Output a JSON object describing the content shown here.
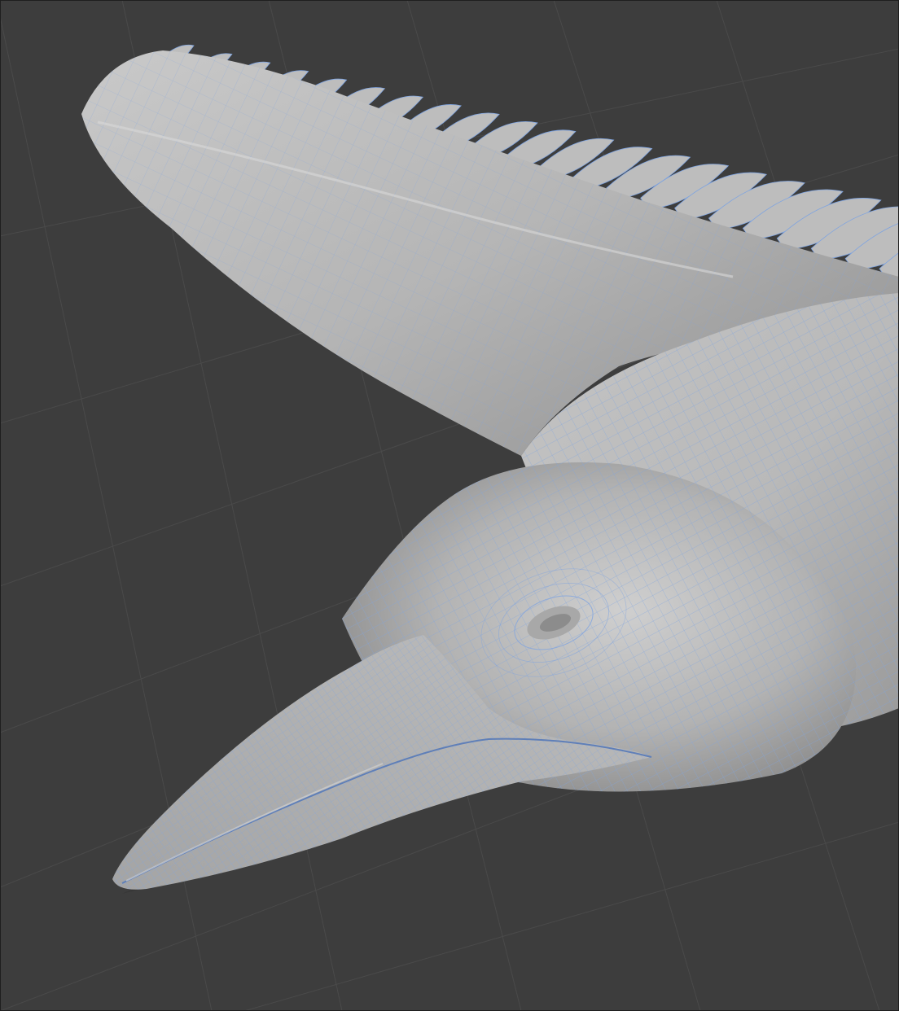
{
  "viewport": {
    "background": "#3d3d3d",
    "grid_color": "#4a4a4a",
    "mesh_color": "#b4b4b4",
    "wire_color": "#7fa4e0",
    "shadow_color": "#2b2b2b",
    "grid_visible": true,
    "wireframe_overlay": true,
    "object": "bird-mesh"
  }
}
